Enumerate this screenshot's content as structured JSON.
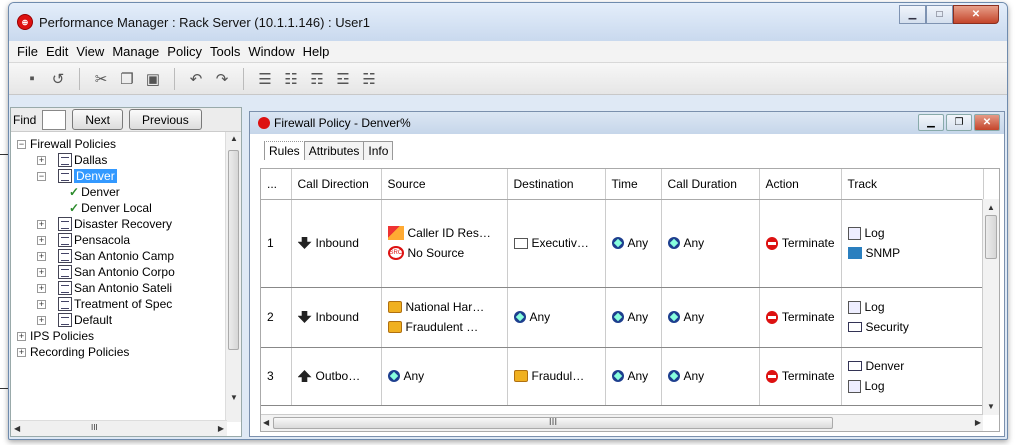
{
  "window": {
    "title": "Performance Manager : Rack Server (10.1.1.146) : User1"
  },
  "menu": [
    "File",
    "Edit",
    "View",
    "Manage",
    "Policy",
    "Tools",
    "Window",
    "Help"
  ],
  "find": {
    "label": "Find",
    "next": "Next",
    "previous": "Previous"
  },
  "tree": {
    "root": "Firewall Policies",
    "items": [
      {
        "label": "Dallas"
      },
      {
        "label": "Denver",
        "selected": true
      },
      {
        "label": "Denver"
      },
      {
        "label": "Denver Local"
      },
      {
        "label": "Disaster Recovery"
      },
      {
        "label": "Pensacola"
      },
      {
        "label": "San Antonio Camp"
      },
      {
        "label": "San Antonio Corpo"
      },
      {
        "label": "San Antonio Sateli"
      },
      {
        "label": "Treatment of Spec"
      },
      {
        "label": "Default"
      }
    ],
    "ips": "IPS Policies",
    "recording": "Recording Policies"
  },
  "panel": {
    "title": "Firewall Policy - Denver%",
    "tabs": [
      "Rules",
      "Attributes",
      "Info"
    ]
  },
  "grid": {
    "columns": [
      "...",
      "Call Direction",
      "Source",
      "Destination",
      "Time",
      "Call Duration",
      "Action",
      "Track"
    ],
    "rows": [
      {
        "num": "1",
        "direction": "Inbound",
        "source": [
          "Caller ID Res…",
          "No Source"
        ],
        "destination": "Executiv…",
        "time": "Any",
        "duration": "Any",
        "action": "Terminate",
        "track": [
          "Log",
          "SNMP"
        ]
      },
      {
        "num": "2",
        "direction": "Inbound",
        "source": [
          "National Har…",
          "Fraudulent …"
        ],
        "destination": "Any",
        "time": "Any",
        "duration": "Any",
        "action": "Terminate",
        "track": [
          "Log",
          "Security"
        ]
      },
      {
        "num": "3",
        "direction": "Outbo…",
        "source": [
          "Any"
        ],
        "destination": "Fraudul…",
        "time": "Any",
        "duration": "Any",
        "action": "Terminate",
        "track": [
          "Denver",
          "Log"
        ]
      }
    ],
    "scroll_label": "III"
  },
  "tree_scroll_label": "III",
  "icons": {
    "app": "globe-icon",
    "terminate_color": "#dd1111",
    "accent": "#3399ff"
  }
}
